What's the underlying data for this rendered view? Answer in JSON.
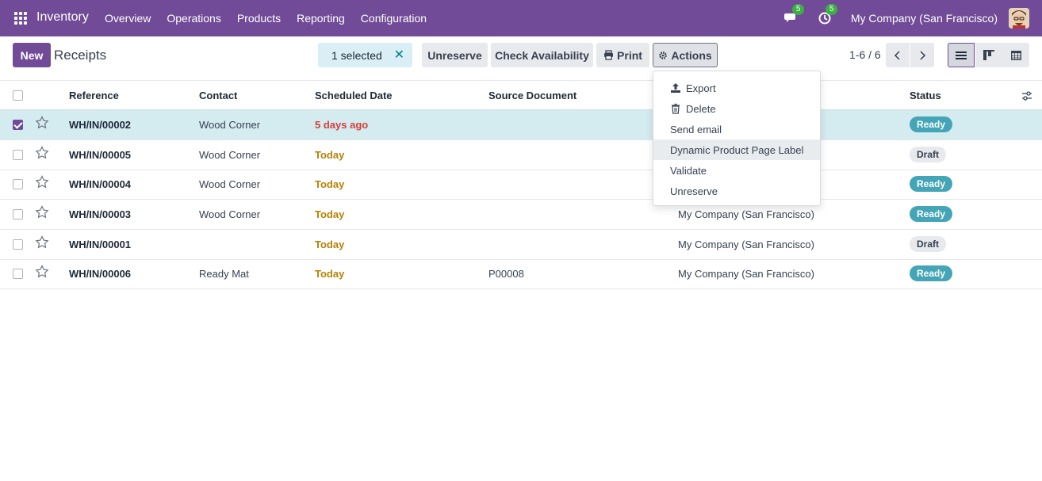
{
  "navbar": {
    "app_name": "Inventory",
    "menu": [
      "Overview",
      "Operations",
      "Products",
      "Reporting",
      "Configuration"
    ],
    "messages_count": "5",
    "activities_count": "5",
    "company": "My Company (San Francisco)"
  },
  "control_panel": {
    "new_label": "New",
    "title": "Receipts",
    "selected_label": "1 selected",
    "unreserve_label": "Unreserve",
    "check_availability_label": "Check Availability",
    "print_label": "Print",
    "actions_label": "Actions",
    "pager": "1-6 / 6"
  },
  "actions_menu": {
    "items": [
      "Export",
      "Delete",
      "Send email",
      "Dynamic Product Page Label",
      "Validate",
      "Unreserve"
    ]
  },
  "table": {
    "columns": [
      "Reference",
      "Contact",
      "Scheduled Date",
      "Source Document",
      "Status"
    ],
    "rows": [
      {
        "reference": "WH/IN/00002",
        "contact": "Wood Corner",
        "date": "5 days ago",
        "source": "",
        "company": "",
        "status": "Ready",
        "selected": true
      },
      {
        "reference": "WH/IN/00005",
        "contact": "Wood Corner",
        "date": "Today",
        "source": "",
        "company": "",
        "status": "Draft",
        "selected": false
      },
      {
        "reference": "WH/IN/00004",
        "contact": "Wood Corner",
        "date": "Today",
        "source": "",
        "company": "",
        "status": "Ready",
        "selected": false
      },
      {
        "reference": "WH/IN/00003",
        "contact": "Wood Corner",
        "date": "Today",
        "source": "",
        "company": "My Company (San Francisco)",
        "status": "Ready",
        "selected": false
      },
      {
        "reference": "WH/IN/00001",
        "contact": "",
        "date": "Today",
        "source": "",
        "company": "My Company (San Francisco)",
        "status": "Draft",
        "selected": false
      },
      {
        "reference": "WH/IN/00006",
        "contact": "Ready Mat",
        "date": "Today",
        "source": "P00008",
        "company": "My Company (San Francisco)",
        "status": "Ready",
        "selected": false
      }
    ]
  },
  "colors": {
    "brand": "#714b97",
    "status_ready": "#44a5b6",
    "date_late": "#d23f3a",
    "date_today": "#b58105"
  }
}
